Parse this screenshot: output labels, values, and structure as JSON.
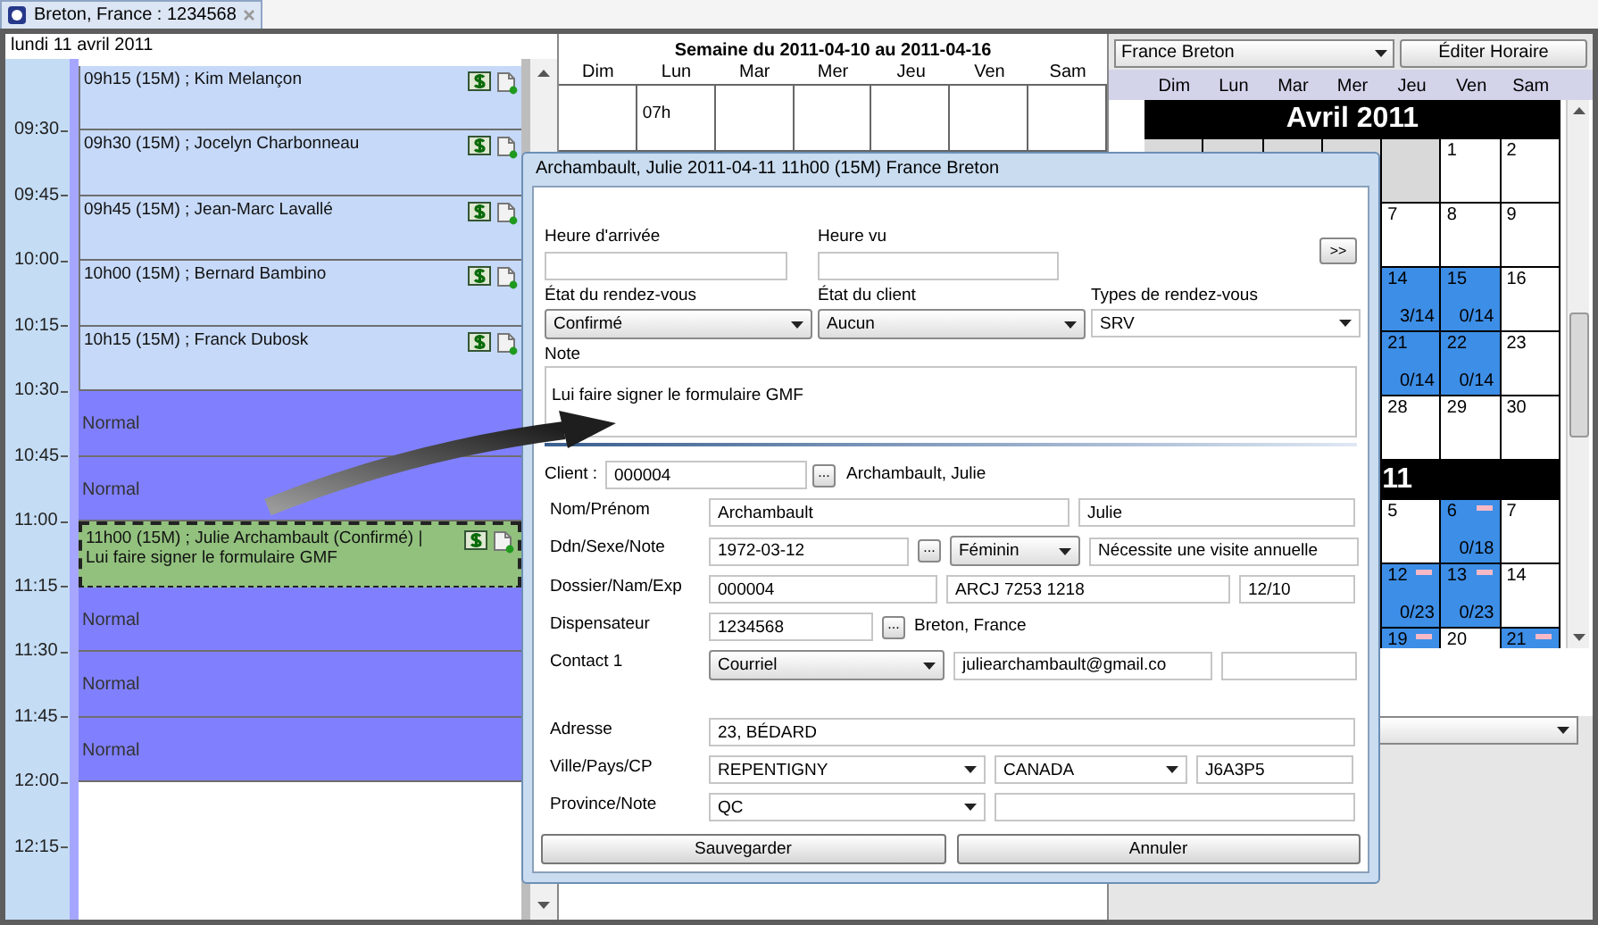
{
  "tab": {
    "title": "Breton, France : 1234568"
  },
  "day_view": {
    "date": "lundi 11 avril 2011",
    "times": [
      "09:30",
      "09:45",
      "10:00",
      "10:15",
      "10:30",
      "10:45",
      "11:00",
      "11:15",
      "11:30",
      "11:45",
      "12:00",
      "12:15"
    ],
    "slots": [
      {
        "kind": "appointment",
        "text": "09h15 (15M) ; Kim Melançon",
        "color": "#c6d9f8",
        "selected": false
      },
      {
        "kind": "appointment",
        "text": "09h30 (15M) ; Jocelyn Charbonneau",
        "color": "#c6d9f8",
        "selected": false
      },
      {
        "kind": "appointment",
        "text": "09h45 (15M) ; Jean-Marc Lavallé",
        "color": "#c6d9f8",
        "selected": false
      },
      {
        "kind": "appointment",
        "text": "10h00 (15M) ; Bernard Bambino",
        "color": "#c6d9f8",
        "selected": false
      },
      {
        "kind": "appointment",
        "text": "10h15 (15M) ; Franck Dubosk",
        "color": "#c6d9f8",
        "selected": false
      },
      {
        "kind": "open",
        "text": "Normal"
      },
      {
        "kind": "open",
        "text": "Normal"
      },
      {
        "kind": "appointment",
        "text": "11h00 (15M) ; Julie Archambault (Confirmé) | Lui faire signer le formulaire GMF",
        "color": "#92c17e",
        "selected": true
      },
      {
        "kind": "open",
        "text": "Normal"
      },
      {
        "kind": "open",
        "text": "Normal"
      },
      {
        "kind": "open",
        "text": "Normal"
      }
    ]
  },
  "week_view": {
    "title": "Semaine du 2011-04-10 au 2011-04-16",
    "days": [
      {
        "label": "Dim"
      },
      {
        "label": "Lun",
        "entry": "07h"
      },
      {
        "label": "Mar"
      },
      {
        "label": "Mer"
      },
      {
        "label": "Jeu"
      },
      {
        "label": "Ven"
      },
      {
        "label": "Sam"
      }
    ]
  },
  "scheduler": {
    "provider": "France Breton",
    "edit_button": "Éditer Horaire",
    "weekdays": [
      "Dim",
      "Lun",
      "Mar",
      "Mer",
      "Jeu",
      "Ven",
      "Sam"
    ],
    "months": [
      {
        "title": "Avril 2011",
        "weeks": [
          [
            {
              "kind": "blank"
            },
            {
              "kind": "day",
              "day": "1",
              "booked": false,
              "flag": false
            },
            {
              "kind": "day",
              "day": "2",
              "booked": false,
              "flag": false
            }
          ],
          [
            {
              "kind": "day",
              "day": "7",
              "booked": false,
              "flag": false
            },
            {
              "kind": "day",
              "day": "8",
              "booked": false,
              "flag": false
            },
            {
              "kind": "day",
              "day": "9",
              "booked": false,
              "flag": false
            }
          ],
          [
            {
              "kind": "day",
              "day": "14",
              "count": "3/14",
              "booked": true,
              "flag": false
            },
            {
              "kind": "day",
              "day": "15",
              "count": "0/14",
              "booked": true,
              "flag": false
            },
            {
              "kind": "day",
              "day": "16",
              "booked": false,
              "flag": false
            }
          ],
          [
            {
              "kind": "day",
              "day": "21",
              "count": "0/14",
              "booked": true,
              "flag": false
            },
            {
              "kind": "day",
              "day": "22",
              "count": "0/14",
              "booked": true,
              "flag": false
            },
            {
              "kind": "day",
              "day": "23",
              "booked": false,
              "flag": false
            }
          ],
          [
            {
              "kind": "day",
              "day": "28",
              "booked": false,
              "flag": false
            },
            {
              "kind": "day",
              "day": "29",
              "booked": false,
              "flag": false
            },
            {
              "kind": "day",
              "day": "30",
              "booked": false,
              "flag": false
            }
          ]
        ]
      },
      {
        "title": "11",
        "weeks": [
          [
            {
              "kind": "day",
              "day": "5",
              "booked": false,
              "flag": false
            },
            {
              "kind": "day",
              "day": "6",
              "count": "0/18",
              "booked": true,
              "flag": true
            },
            {
              "kind": "day",
              "day": "7",
              "booked": false,
              "flag": false
            }
          ],
          [
            {
              "kind": "day",
              "day": "12",
              "count": "0/23",
              "booked": true,
              "flag": true
            },
            {
              "kind": "day",
              "day": "13",
              "count": "0/23",
              "booked": true,
              "flag": true
            },
            {
              "kind": "day",
              "day": "14",
              "booked": false,
              "flag": false
            }
          ],
          [
            {
              "kind": "day",
              "day": "19",
              "booked": true,
              "flag": true
            },
            {
              "kind": "day",
              "day": "20",
              "booked": false,
              "flag": false
            },
            {
              "kind": "day",
              "day": "21",
              "booked": true,
              "flag": true
            }
          ]
        ]
      }
    ]
  },
  "dialog": {
    "title": "Archambault, Julie 2011-04-11 11h00 (15M) France Breton",
    "expand_button": ">>",
    "time_fields": [
      {
        "label": "Heure d'arrivée"
      },
      {
        "label": "Heure vu"
      }
    ],
    "status_fields": [
      {
        "label": "État du rendez-vous",
        "value": "Confirmé",
        "kind": "select"
      },
      {
        "label": "État du client",
        "value": "Aucun",
        "kind": "select"
      },
      {
        "label": "Types de rendez-vous",
        "value": "SRV",
        "kind": "combo"
      }
    ],
    "note": {
      "label": "Note",
      "value": "Lui faire signer le formulaire GMF"
    },
    "client": {
      "label": "Client :",
      "value": "000004",
      "browse": "...",
      "name": "Archambault, Julie"
    },
    "rows": [
      {
        "label": "Nom/Prénom",
        "controls": [
          {
            "kind": "input",
            "value": "Archambault"
          },
          {
            "kind": "input",
            "value": "Julie"
          }
        ]
      },
      {
        "label": "Ddn/Sexe/Note",
        "controls": [
          {
            "kind": "input",
            "value": "1972-03-12"
          },
          {
            "kind": "browse",
            "value": "..."
          },
          {
            "kind": "select",
            "value": "Féminin"
          },
          {
            "kind": "input",
            "value": "Nécessite une visite annuelle"
          }
        ]
      },
      {
        "label": "Dossier/Nam/Exp",
        "controls": [
          {
            "kind": "input",
            "value": "000004"
          },
          {
            "kind": "input",
            "value": "ARCJ 7253 1218"
          },
          {
            "kind": "input",
            "value": "12/10"
          }
        ]
      },
      {
        "label": "Dispensateur",
        "controls": [
          {
            "kind": "input",
            "value": "1234568"
          },
          {
            "kind": "browse",
            "value": "..."
          },
          {
            "kind": "text",
            "value": "Breton, France"
          }
        ]
      },
      {
        "label": "Contact 1",
        "controls": [
          {
            "kind": "select",
            "value": "Courriel"
          },
          {
            "kind": "input",
            "value": "juliearchambault@gmail.co"
          },
          {
            "kind": "input"
          }
        ]
      },
      {
        "label": "Adresse",
        "controls": [
          {
            "kind": "input",
            "value": "23, BÉDARD"
          }
        ]
      },
      {
        "label": "Ville/Pays/CP",
        "controls": [
          {
            "kind": "combo",
            "value": "REPENTIGNY"
          },
          {
            "kind": "combo",
            "value": "CANADA"
          },
          {
            "kind": "input",
            "value": "J6A3P5"
          }
        ]
      },
      {
        "label": "Province/Note",
        "controls": [
          {
            "kind": "combo",
            "value": "QC"
          },
          {
            "kind": "input"
          }
        ]
      }
    ],
    "buttons": [
      "Sauvegarder",
      "Annuler"
    ]
  }
}
